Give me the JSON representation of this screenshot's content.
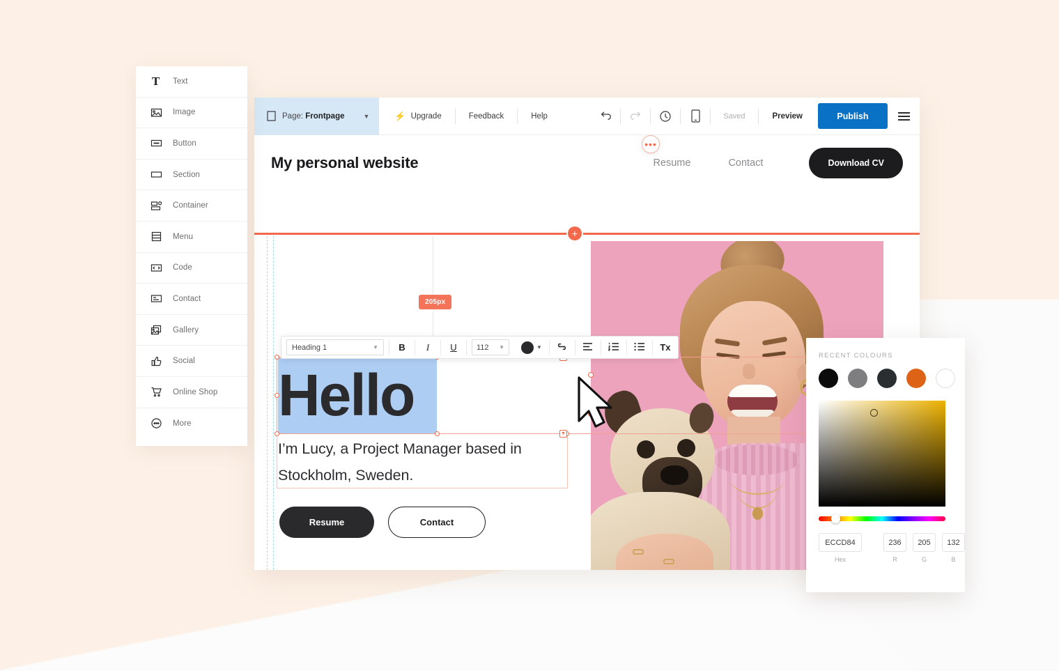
{
  "elements_panel": {
    "items": [
      {
        "label": "Text",
        "icon": "text-icon"
      },
      {
        "label": "Image",
        "icon": "image-icon"
      },
      {
        "label": "Button",
        "icon": "button-icon"
      },
      {
        "label": "Section",
        "icon": "section-icon"
      },
      {
        "label": "Container",
        "icon": "container-icon"
      },
      {
        "label": "Menu",
        "icon": "menu-icon"
      },
      {
        "label": "Code",
        "icon": "code-icon"
      },
      {
        "label": "Contact",
        "icon": "contact-icon"
      },
      {
        "label": "Gallery",
        "icon": "gallery-icon"
      },
      {
        "label": "Social",
        "icon": "social-icon"
      },
      {
        "label": "Online Shop",
        "icon": "shopping-cart-icon"
      },
      {
        "label": "More",
        "icon": "more-icon"
      }
    ]
  },
  "toolbar": {
    "page_prefix": "Page:",
    "page_name": "Frontpage",
    "upgrade": "Upgrade",
    "feedback": "Feedback",
    "help": "Help",
    "saved": "Saved",
    "preview": "Preview",
    "publish": "Publish",
    "publish_color": "#0A72C4",
    "page_chip_color": "#D6E8F5",
    "bolt_color": "#C026D3"
  },
  "site": {
    "title": "My personal website",
    "nav": [
      "Resume",
      "Contact"
    ],
    "cta": "Download CV"
  },
  "canvas": {
    "spacing_badge": "205px",
    "spacing_badge_color": "#F4745A",
    "rail_color": "#F26A4B",
    "heading": "Hello",
    "paragraph": "I’m Lucy, a Project Manager based in Stockholm, Sweden.",
    "buttons": [
      "Resume",
      "Contact"
    ],
    "selection_highlight_color": "#AECDF3",
    "photo_background_color": "#EDA3BC"
  },
  "text_toolbar": {
    "style": "Heading 1",
    "bold": "B",
    "italic": "I",
    "underline": "U",
    "font_size": "112",
    "color_swatch": "#2A2A2C",
    "link_icon": "link-icon",
    "align_icon": "align-icon",
    "ordered_list_icon": "ordered-list-icon",
    "bullet_list_icon": "bullet-list-icon",
    "clear_format_label": "Tx",
    "more_label": "•••"
  },
  "colour_picker": {
    "title": "RECENT COLOURS",
    "swatches": [
      "#0B0B0B",
      "#7E7E80",
      "#2A2E31",
      "#DD6317",
      "#FFFFFF"
    ],
    "hex_value": "ECCD84",
    "hex_label": "Hex",
    "r_value": "236",
    "g_value": "205",
    "b_value": "132",
    "r_label": "R",
    "g_label": "G",
    "b_label": "B"
  }
}
